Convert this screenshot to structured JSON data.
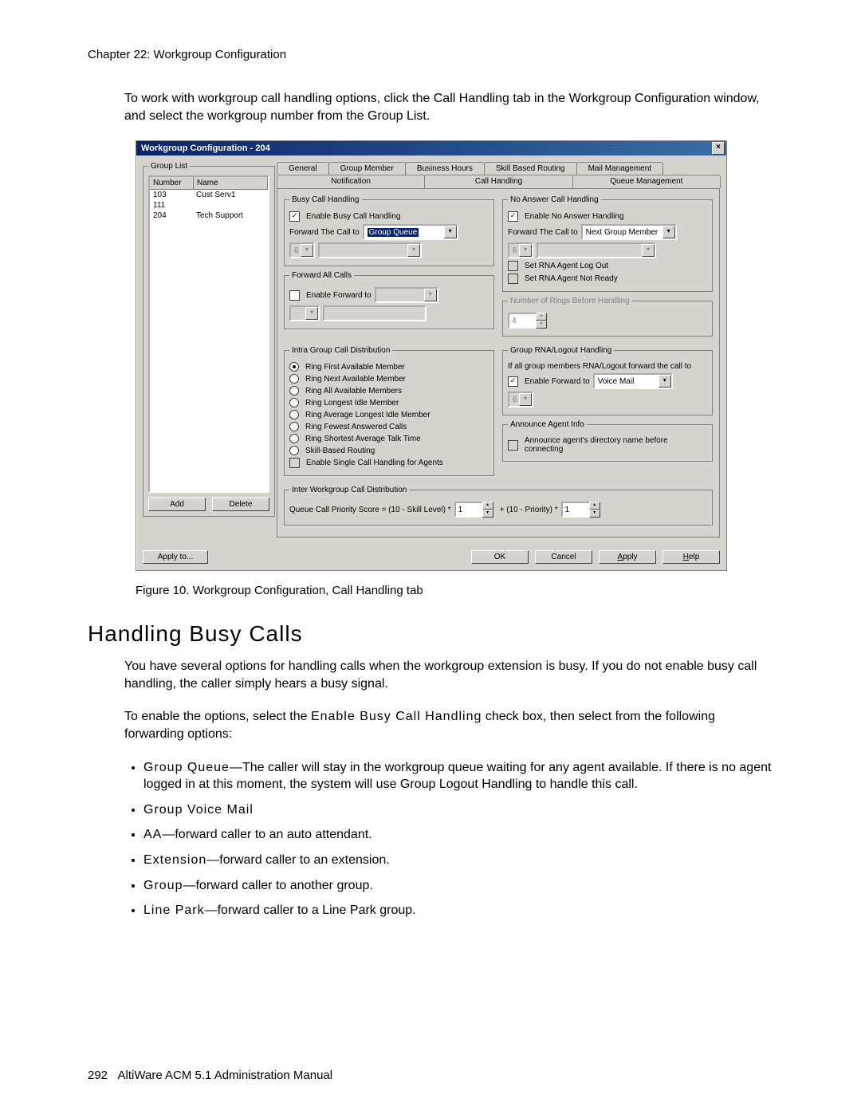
{
  "chapter": "Chapter 22:  Workgroup Configuration",
  "intro": "To work with workgroup call handling options, click the Call Handling tab in the Workgroup Configuration window, and select the workgroup number from the Group List.",
  "dialog": {
    "title": "Workgroup Configuration - 204",
    "groupListLegend": "Group List",
    "cols": {
      "num": "Number",
      "name": "Name"
    },
    "rows": [
      {
        "num": "103",
        "name": "Cust Serv1"
      },
      {
        "num": "111",
        "name": ""
      },
      {
        "num": "204",
        "name": "Tech Support"
      }
    ],
    "btnAdd": "Add",
    "btnDelete": "Delete",
    "tabs": {
      "r1": [
        "General",
        "Group Member",
        "Business Hours",
        "Skill Based Routing",
        "Mail Management"
      ],
      "r2": [
        "Notification",
        "Call Handling",
        "Queue Management"
      ]
    },
    "busy": {
      "legend": "Busy Call Handling",
      "enable": "Enable Busy Call Handling",
      "fwdLbl": "Forward The Call to",
      "fwdSel": "Group Queue",
      "smallVal": "6"
    },
    "fwdAll": {
      "legend": "Forward All Calls",
      "enable": "Enable Forward to"
    },
    "noAns": {
      "legend": "No Answer Call Handling",
      "enable": "Enable No Answer Handling",
      "fwdLbl": "Forward The Call to",
      "fwdSel": "Next Group Member",
      "smallVal": "6",
      "rnaLogout": "Set RNA Agent Log Out",
      "rnaNotReady": "Set RNA Agent Not Ready"
    },
    "ringsBefore": {
      "legend": "Number of Rings Before Handling",
      "val": "4"
    },
    "intra": {
      "legend": "Intra Group Call Distribution",
      "opts": [
        "Ring First Available Member",
        "Ring Next Available Member",
        "Ring All Available Members",
        "Ring Longest Idle Member",
        "Ring Average Longest Idle Member",
        "Ring Fewest Answered Calls",
        "Ring Shortest Average Talk Time",
        "Skill-Based Routing"
      ],
      "single": "Enable Single Call Handling for Agents"
    },
    "rna": {
      "legend": "Group RNA/Logout Handling",
      "desc": "If all group members RNA/Logout forward the call to",
      "enable": "Enable Forward to",
      "fwdSel": "Voice Mail",
      "smallVal": "6"
    },
    "agentInfo": {
      "legend": "Announce Agent Info",
      "opt": "Announce agent's directory name before connecting"
    },
    "inter": {
      "legend": "Inter Workgroup Call Distribution",
      "formulaA": "Queue Call Priority Score = (10 - Skill Level) *",
      "valA": "1",
      "formulaB": " + (10 - Priority) * ",
      "valB": "1"
    },
    "applyTo": "Apply to...",
    "ok": "OK",
    "cancel": "Cancel",
    "apply": "Apply",
    "help": "Help"
  },
  "figcap": "Figure 10.   Workgroup Configuration, Call Handling tab",
  "h2": "Handling Busy Calls",
  "p1": "You have several options for handling calls when the workgroup extension is busy. If you do not enable busy call handling, the caller simply hears a busy signal.",
  "p2a": "To enable the options, select the ",
  "p2b": "Enable Busy Call Handling",
  "p2c": " check box, then select from the following forwarding options:",
  "opts": [
    {
      "t": "Group Queue",
      "d": "—The caller will stay in the workgroup queue waiting for any agent available. If there is no agent logged in at this moment, the system will use Group Logout Handling to handle this call."
    },
    {
      "t": "Group Voice Mail",
      "d": ""
    },
    {
      "t": "AA",
      "d": "—forward caller to an auto attendant."
    },
    {
      "t": "Extension",
      "d": "—forward caller to an extension."
    },
    {
      "t": "Group",
      "d": "—forward caller to another group."
    },
    {
      "t": "Line Park",
      "d": "—forward caller to a Line Park group."
    }
  ],
  "footer": {
    "pg": "292",
    "man": "AltiWare ACM 5.1 Administration Manual"
  }
}
